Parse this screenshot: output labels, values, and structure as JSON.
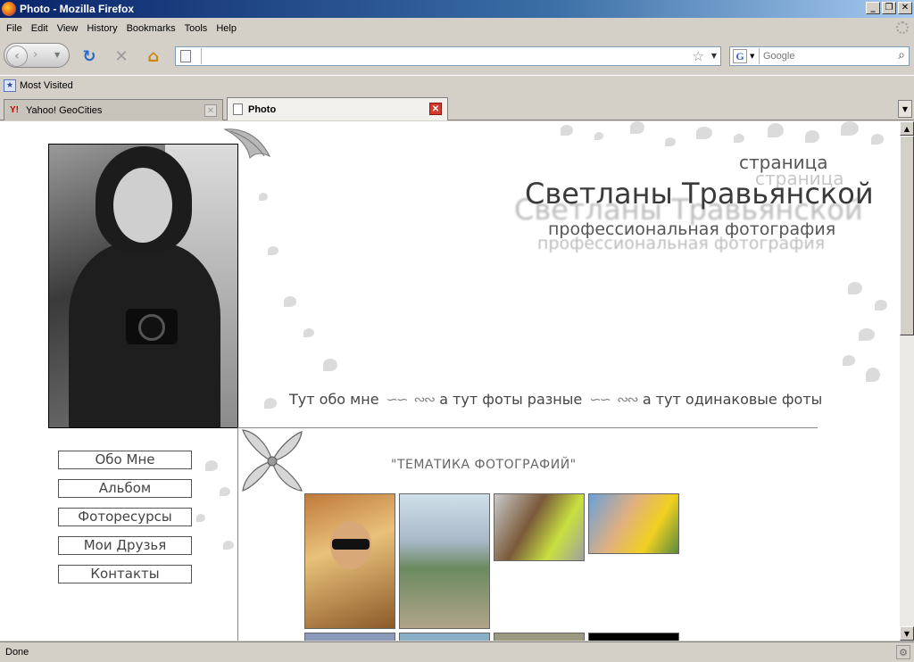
{
  "window": {
    "title": "Photo - Mozilla Firefox",
    "minimize": "_",
    "maximize": "❐",
    "close": "✕"
  },
  "menu": {
    "file": "File",
    "edit": "Edit",
    "view": "View",
    "history": "History",
    "bookmarks": "Bookmarks",
    "tools": "Tools",
    "help": "Help"
  },
  "urlbar": {
    "value": "",
    "placeholder": ""
  },
  "search": {
    "engine": "G",
    "placeholder": "Google"
  },
  "bookmarks": {
    "most_visited": "Most Visited"
  },
  "tabs": [
    {
      "label": "Yahoo! GeoCities"
    },
    {
      "label": "Photo"
    }
  ],
  "page": {
    "header": {
      "line1": "страница",
      "line2": "Светланы Травьянской",
      "line3": "профессиональная фотография"
    },
    "topnav": {
      "about": "Тут обо мне",
      "various": "а тут фоты разные",
      "same": "а тут одинаковые фоты"
    },
    "side_menu": [
      "Обо Мне",
      "Альбом",
      "Фоторесурсы",
      "Мои Друзья",
      "Контакты"
    ],
    "section_title": "\"ТЕМАТИКА ФОТОГРАФИЙ\""
  },
  "status": {
    "text": "Done"
  }
}
